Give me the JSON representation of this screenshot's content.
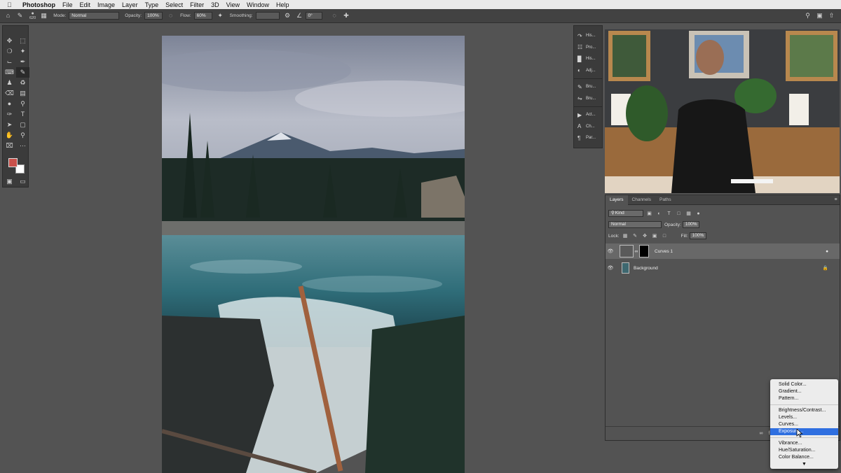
{
  "menubar": {
    "app_name": "Photoshop",
    "items": [
      "File",
      "Edit",
      "Image",
      "Layer",
      "Type",
      "Select",
      "Filter",
      "3D",
      "View",
      "Window",
      "Help"
    ]
  },
  "options_bar": {
    "brush_size": "620",
    "mode_label": "Mode:",
    "mode_value": "Normal",
    "opacity_label": "Opacity:",
    "opacity_value": "100%",
    "flow_label": "Flow:",
    "flow_value": "60%",
    "smoothing_label": "Smoothing:",
    "smoothing_value": "",
    "angle_value": "0°"
  },
  "colors": {
    "foreground": "#c9504a",
    "background": "#ffffff",
    "highlight": "#2f6fe0"
  },
  "collapsed_panels": [
    {
      "label": "His...",
      "icon": "history-icon"
    },
    {
      "label": "Pro...",
      "icon": "properties-icon"
    },
    {
      "label": "His...",
      "icon": "histogram-icon"
    },
    {
      "label": "Adj...",
      "icon": "adjustments-icon"
    },
    {
      "label": "Bru...",
      "icon": "brush-icon"
    },
    {
      "label": "Bru...",
      "icon": "brush-settings-icon"
    },
    {
      "label": "Act...",
      "icon": "actions-icon"
    },
    {
      "label": "Ch...",
      "icon": "character-icon"
    },
    {
      "label": "Par...",
      "icon": "paragraph-icon"
    }
  ],
  "layers_panel": {
    "tabs": [
      "Layers",
      "Channels",
      "Paths"
    ],
    "kind_label": "Kind",
    "blend_mode": "Normal",
    "opacity_label": "Opacity:",
    "opacity_value": "100%",
    "lock_label": "Lock:",
    "fill_label": "Fill:",
    "fill_value": "100%",
    "layers": [
      {
        "name": "Curves 1",
        "selected": true
      },
      {
        "name": "Background",
        "selected": false
      }
    ]
  },
  "adjustment_menu": {
    "group1": [
      "Solid Color...",
      "Gradient...",
      "Pattern..."
    ],
    "group2": [
      "Brightness/Contrast...",
      "Levels...",
      "Curves...",
      "Exposure..."
    ],
    "group3": [
      "Vibrance...",
      "Hue/Saturation...",
      "Color Balance..."
    ],
    "highlighted": "Exposure..."
  }
}
